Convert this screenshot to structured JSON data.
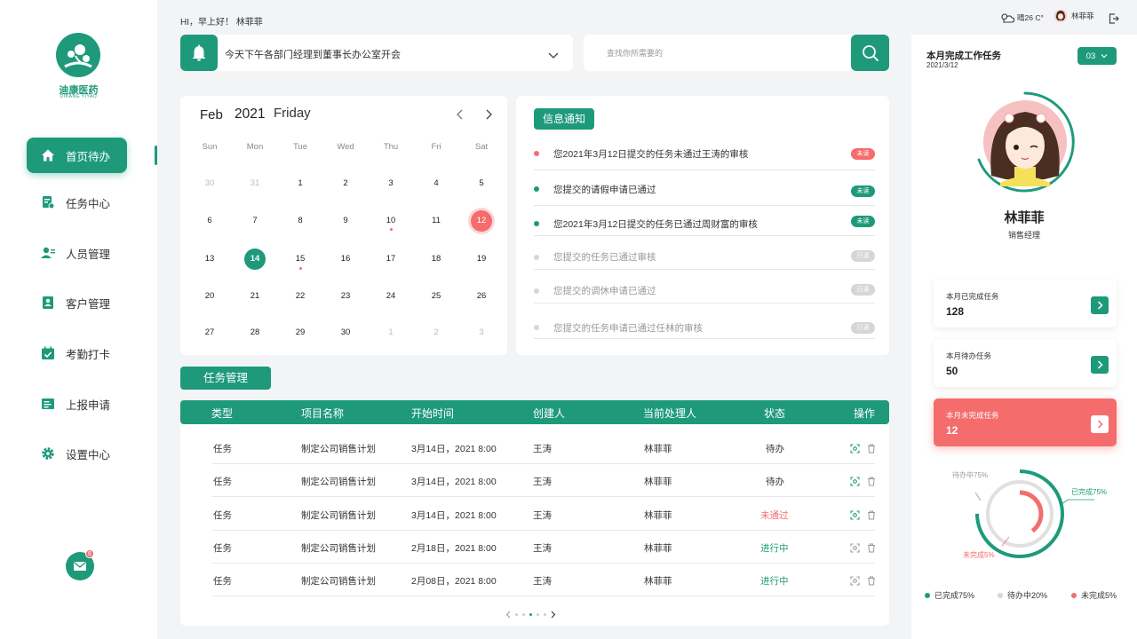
{
  "app": {
    "name": "迪康医药",
    "name_en": "DIKANG YIYAO"
  },
  "nav": [
    {
      "label": "首页待办",
      "icon": "home-icon",
      "active": true
    },
    {
      "label": "任务中心",
      "icon": "task-icon"
    },
    {
      "label": "人员管理",
      "icon": "people-icon"
    },
    {
      "label": "客户管理",
      "icon": "contacts-icon"
    },
    {
      "label": "考勤打卡",
      "icon": "calendar-check-icon"
    },
    {
      "label": "上报申请",
      "icon": "report-icon"
    },
    {
      "label": "设置中心",
      "icon": "gear-icon"
    }
  ],
  "mail": {
    "badge": "6"
  },
  "header": {
    "greeting": "HI，早上好！ 林菲菲",
    "weather": "晴26 C°",
    "user": "林菲菲"
  },
  "announcement": {
    "text": "今天下午各部门经理到董事长办公室开会"
  },
  "search": {
    "placeholder": "查找你所需要的"
  },
  "calendar": {
    "month": "Feb",
    "year": "2021",
    "weekday": "Friday",
    "weekdays": [
      "Sun",
      "Mon",
      "Tue",
      "Wed",
      "Thu",
      "Fri",
      "Sat"
    ],
    "days": [
      [
        "30",
        "31",
        "1",
        "2",
        "3",
        "4",
        "5"
      ],
      [
        "6",
        "7",
        "8",
        "9",
        "10",
        "11",
        "12"
      ],
      [
        "13",
        "14",
        "15",
        "16",
        "17",
        "18",
        "19"
      ],
      [
        "20",
        "21",
        "22",
        "23",
        "24",
        "25",
        "26"
      ],
      [
        "27",
        "28",
        "29",
        "30",
        "1",
        "2",
        "3"
      ]
    ]
  },
  "notices": {
    "tab": "信息通知",
    "items": [
      {
        "text": "您2021年3月12日提交的任务未通过王涛的审核",
        "badge": "未读",
        "status": "unread-red"
      },
      {
        "text": "您提交的请假申请已通过",
        "badge": "未读",
        "status": "unread"
      },
      {
        "text": "您2021年3月12日提交的任务已通过周财富的审核",
        "badge": "未读",
        "status": "unread"
      },
      {
        "text": "您提交的任务已通过审核",
        "badge": "已读",
        "status": "read"
      },
      {
        "text": "您提交的调休申请已通过",
        "badge": "已读",
        "status": "read"
      },
      {
        "text": "您提交的任务申请已通过任林的审核",
        "badge": "已读",
        "status": "read"
      }
    ]
  },
  "tasks": {
    "tab": "任务管理",
    "headers": [
      "类型",
      "项目名称",
      "开始时间",
      "创建人",
      "当前处理人",
      "状态",
      "操作"
    ],
    "rows": [
      [
        "任务",
        "制定公司销售计划",
        "3月14日，2021 8:00",
        "王涛",
        "林菲菲",
        "待办"
      ],
      [
        "任务",
        "制定公司销售计划",
        "3月14日，2021 8:00",
        "王涛",
        "林菲菲",
        "待办"
      ],
      [
        "任务",
        "制定公司销售计划",
        "3月14日，2021 8:00",
        "王涛",
        "林菲菲",
        "未通过"
      ],
      [
        "任务",
        "制定公司销售计划",
        "2月18日，2021 8:00",
        "王涛",
        "林菲菲",
        "进行中"
      ],
      [
        "任务",
        "制定公司销售计划",
        "2月08日，2021 8:00",
        "王涛",
        "林菲菲",
        "进行中"
      ]
    ]
  },
  "right": {
    "title": "本月完成工作任务",
    "date": "2021/3/12",
    "month_select": "03",
    "name": "林菲菲",
    "role": "销售经理",
    "stats": [
      {
        "label": "本月已完成任务",
        "value": "128"
      },
      {
        "label": "本月待办任务",
        "value": "50"
      },
      {
        "label": "本月未完成任务",
        "value": "12"
      }
    ],
    "ring_labels": {
      "pending": "待办中75%",
      "done": "已完成75%",
      "undone": "未完成5%"
    },
    "legend": [
      "已完成75%",
      "待办中20%",
      "未完成5%"
    ]
  },
  "colors": {
    "accent": "#1e9a7b",
    "danger": "#f56c6c",
    "muted": "#d6d6d6"
  }
}
